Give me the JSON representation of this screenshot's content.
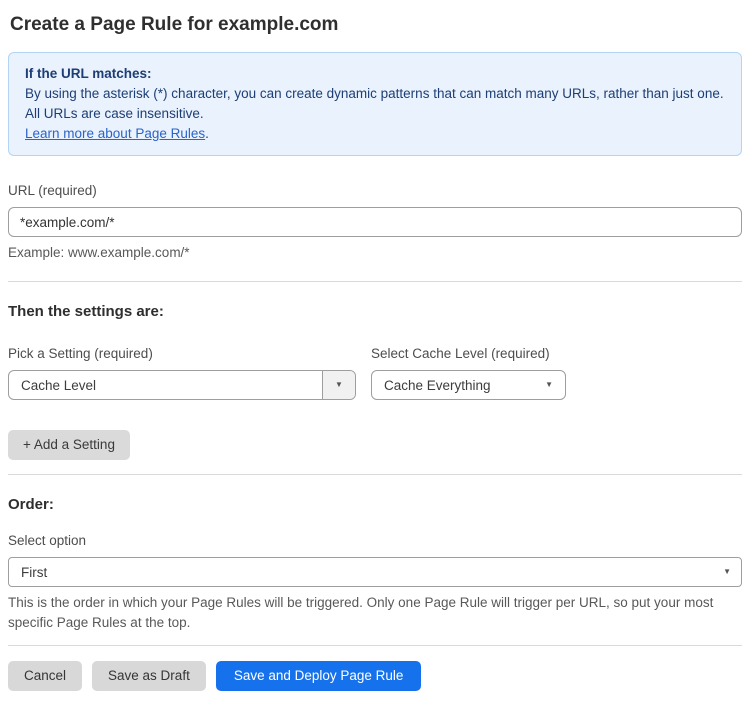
{
  "page": {
    "title": "Create a Page Rule for example.com"
  },
  "colors": {
    "accent_blue": "#1672ec",
    "info_background": "#e9f2fd",
    "info_border": "#b3d4f5",
    "info_text": "#1d3e75",
    "link_blue": "#2b63c9"
  },
  "info_box": {
    "heading": "If the URL matches:",
    "body": "By using the asterisk (*) character, you can create dynamic patterns that can match many URLs, rather than just one. All URLs are case insensitive.",
    "link_label": "Learn more about Page Rules",
    "link_suffix": "."
  },
  "url_field": {
    "label": "URL (required)",
    "value": "*example.com/*",
    "helper": "Example: www.example.com/*"
  },
  "settings": {
    "heading": "Then the settings are:",
    "setting_select": {
      "label": "Pick a Setting (required)",
      "value": "Cache Level"
    },
    "cache_level_select": {
      "label": "Select Cache Level (required)",
      "value": "Cache Everything"
    },
    "add_button_label": "+ Add a Setting"
  },
  "order": {
    "heading": "Order:",
    "label": "Select option",
    "value": "First",
    "helper": "This is the order in which your Page Rules will be triggered. Only one Page Rule will trigger per URL, so put your most specific Page Rules at the top."
  },
  "footer": {
    "cancel_label": "Cancel",
    "save_draft_label": "Save as Draft",
    "deploy_label": "Save and Deploy Page Rule"
  }
}
